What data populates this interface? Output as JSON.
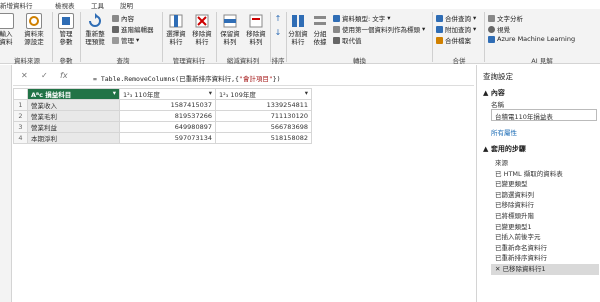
{
  "tabs": [
    "新增資料行",
    "檢視表",
    "工具",
    "說明"
  ],
  "ribbon": {
    "data_source": {
      "new_source_label": "輸入\n資料",
      "settings_label": "資料來\n源設定",
      "group_label": "資料來源"
    },
    "params": {
      "manage_params_label": "管理\n參數",
      "group_label": "參數"
    },
    "query": {
      "refresh_preview_label": "重新整\n理預覽",
      "properties_label": "內容",
      "advanced_editor_label": "進階編輯器",
      "manage_label": "管理",
      "group_label": "查詢"
    },
    "manage_columns": {
      "choose_columns_label": "選擇資\n料行",
      "remove_columns_label": "移除資\n料行",
      "group_label": "管理資料行"
    },
    "reduce_rows": {
      "keep_rows_label": "保留資\n料列",
      "remove_rows_label": "移除資\n料列",
      "group_label": "縮減資料列"
    },
    "sort": {
      "group_label": "排序"
    },
    "transform": {
      "split_column_label": "分割資\n料行",
      "group_by_label": "分組\n依據",
      "data_type_label": "資料類型: 文字",
      "use_first_row_label": "使用第一個資料列作為標頭",
      "replace_values_label": "取代值",
      "group_label": "轉換"
    },
    "combine": {
      "merge_queries_label": "合併查詢",
      "append_queries_label": "附加查詢",
      "combine_files_label": "合併檔案",
      "group_label": "合併"
    },
    "ai": {
      "text_analytics_label": "文字分析",
      "vision_label": "視覺",
      "azure_ml_label": "Azure Machine Learning",
      "group_label": "AI 見解"
    }
  },
  "formula": {
    "prefix": "= Table.RemoveColumns(已重新排序資料行,{",
    "string": "\"會計項目\"",
    "suffix": "})"
  },
  "grid": {
    "headers": [
      "損益科目",
      "110年度",
      "109年度"
    ],
    "rows": [
      {
        "n": "1",
        "name": "營業收入",
        "v110": "1587415037",
        "v109": "1339254811"
      },
      {
        "n": "2",
        "name": "營業毛利",
        "v110": "819537266",
        "v109": "711130120"
      },
      {
        "n": "3",
        "name": "營業利益",
        "v110": "649980897",
        "v109": "566783698"
      },
      {
        "n": "4",
        "name": "本期淨利",
        "v110": "597073134",
        "v109": "518158082"
      }
    ]
  },
  "panel": {
    "title": "查詢設定",
    "properties_heading": "▲ 內容",
    "name_label": "名稱",
    "name_value": "台積電110年損益表",
    "all_properties_link": "所有屬性",
    "applied_steps_heading": "▲ 套用的步驟",
    "steps": [
      "來源",
      "已 HTML 擷取的資料表",
      "已變更類型",
      "已篩選資料列",
      "已移除資料行",
      "已將標頭升階",
      "已變更類型1",
      "已插入前後字元",
      "已重新命名資料行",
      "已重新排序資料行",
      "已移除資料行1"
    ]
  },
  "colors": {
    "accent": "#217346",
    "ribbon_bg": "#f3f3f3"
  }
}
